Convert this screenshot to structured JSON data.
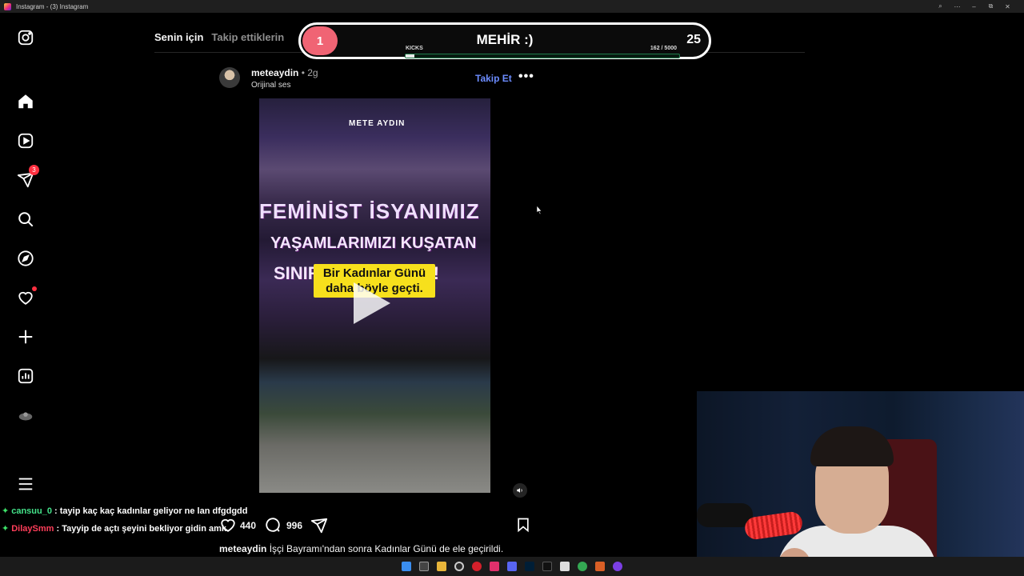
{
  "window": {
    "title": "Instagram - (3) Instagram",
    "controls": [
      "⌕",
      "⋯",
      "–",
      "⧉",
      "✕"
    ]
  },
  "nav": {
    "items": [
      {
        "name": "instagram-logo-icon"
      },
      {
        "name": "home-icon"
      },
      {
        "name": "reels-icon"
      },
      {
        "name": "messages-icon",
        "badge": "3"
      },
      {
        "name": "search-icon"
      },
      {
        "name": "explore-icon"
      },
      {
        "name": "notifications-icon"
      },
      {
        "name": "create-icon"
      },
      {
        "name": "dashboard-icon"
      },
      {
        "name": "profile-icon"
      },
      {
        "name": "menu-icon"
      }
    ]
  },
  "tabs": {
    "for_you": "Senin için",
    "following": "Takip ettiklerin"
  },
  "goal": {
    "level": "1",
    "title": "MEHİR :)",
    "count": "25",
    "label": "KICKS",
    "progress_text": "162  / 5000",
    "progress": 0.0324
  },
  "post": {
    "username": "meteaydin",
    "time": "• 2g",
    "audio": "Orijinal ses",
    "follow": "Takip Et",
    "more": "•••",
    "video": {
      "watermark": "METE AYDIN",
      "banner_line1": "FEMİNİST İSYANIMIZ",
      "banner_line2": "YAŞAMLARIMIZI KUŞATAN",
      "banner_line3": "SINIRLARI AŞIYOR!",
      "caption": "Bir Kadınlar Günü daha böyle geçti."
    },
    "likes": "440",
    "comments": "996",
    "caption_user": "meteaydin",
    "caption_text": "İşçi Bayramı'ndan sonra Kadınlar Günü de ele geçirildi."
  },
  "chat": [
    {
      "user": "cansuu_0",
      "text": ": tayip kaç kaç kadınlar geliyor ne lan dfgdgdd"
    },
    {
      "user": "DilaySmm",
      "text": ": Tayyip de açtı şeyini bekliyor gidin amk"
    }
  ],
  "colors": {
    "accent_follow": "#6c8cff",
    "badge": "#ff3040",
    "goal_circle": "#f06474"
  }
}
